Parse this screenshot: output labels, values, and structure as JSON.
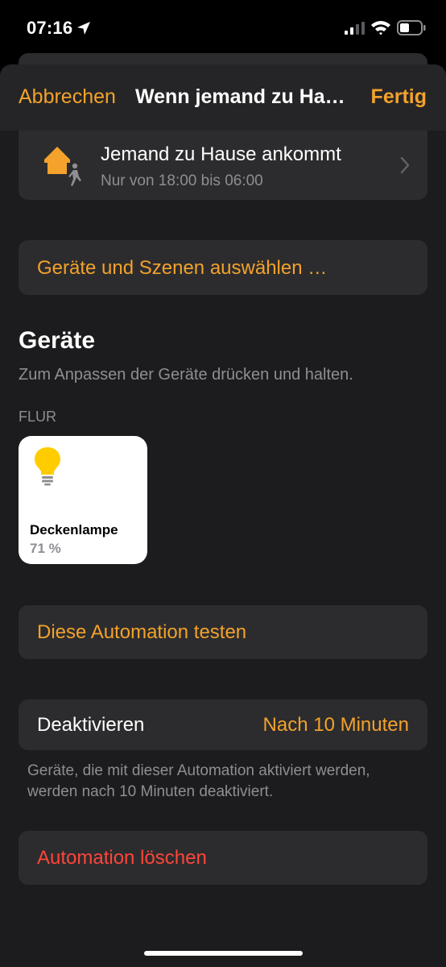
{
  "status_bar": {
    "time": "07:16"
  },
  "nav": {
    "cancel_label": "Abbrechen",
    "title": "Wenn jemand zu Ha…",
    "done_label": "Fertig"
  },
  "trigger": {
    "title": "Jemand zu Hause ankommt",
    "subtitle": "Nur von 18:00 bis 06:00",
    "icon": "person-arrives-home-icon"
  },
  "select_devices_label": "Geräte und Szenen auswählen …",
  "devices_section": {
    "title": "Geräte",
    "hint": "Zum Anpassen der Geräte drücken und halten.",
    "room": "FLUR",
    "tiles": [
      {
        "name": "Deckenlampe",
        "value": "71 %",
        "icon": "lightbulb-icon"
      }
    ]
  },
  "test_automation_label": "Diese Automation testen",
  "deactivate": {
    "label": "Deaktivieren",
    "value": "Nach 10 Minuten",
    "footnote": "Geräte, die mit dieser Automation aktiviert werden, werden nach 10 Minuten deaktiviert."
  },
  "delete_label": "Automation löschen",
  "colors": {
    "accent": "#f3a22b",
    "destructive": "#ff453a",
    "card_background": "#2c2c2e",
    "sheet_background": "#1c1c1e",
    "secondary_text": "#8e8e93"
  }
}
